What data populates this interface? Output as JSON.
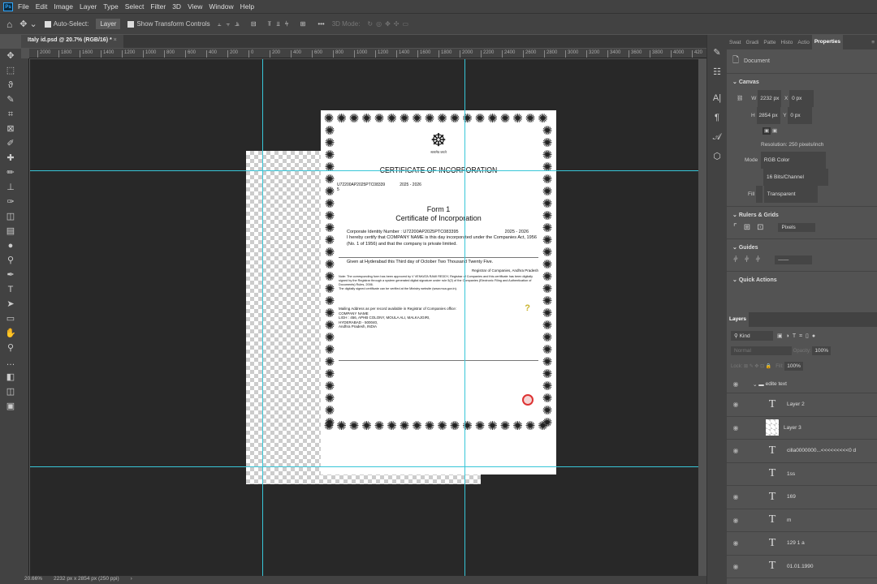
{
  "app_icon": "Ps",
  "menu": [
    "File",
    "Edit",
    "Image",
    "Layer",
    "Type",
    "Select",
    "Filter",
    "3D",
    "View",
    "Window",
    "Help"
  ],
  "options": {
    "auto_select": "Auto-Select:",
    "auto_select_target": "Layer",
    "show_transform": "Show Transform Controls",
    "mode_3d": "3D Mode:",
    "more": "•••"
  },
  "document_tab": {
    "title": "Italy id.psd @ 20.7% (RGB/16) *",
    "close": "×"
  },
  "ruler_top": [
    "2000",
    "1800",
    "1600",
    "1400",
    "1200",
    "1000",
    "800",
    "600",
    "400",
    "200",
    "0",
    "200",
    "400",
    "600",
    "800",
    "1000",
    "1200",
    "1400",
    "1600",
    "1800",
    "2000",
    "2200",
    "2400",
    "2600",
    "2800",
    "3000",
    "3200",
    "3400",
    "3600",
    "3800",
    "4000",
    "420"
  ],
  "certificate": {
    "ornament": "✺",
    "emblem": "☸",
    "emblem_caption": "सत्यमेव जयते",
    "heading": "CERTIFICATE OF INCORPORATION",
    "cin_top": "U72200AP2025PTC08339",
    "cin_top_cont": "5",
    "year_top": "2025 - 2026",
    "form": "Form 1",
    "subtitle": "Certificate of Incorporation",
    "cin_line": "Corporate Identity Number : U72200AP2025PTC083395",
    "year_line": "2025 - 2026",
    "certify": "I hereby certify that COMPANY NAME is this day incorporated under the Companies Act, 1956 (No. 1 of 1956) and that the company is private limited.",
    "given": "Given at Hyderabad this  Third day of October Two Thousand Twenty Five.",
    "registrar": "Registrar of Companies, Andhra Pradesh",
    "note": "Note: The corresponding form has been approved by V VENKATA RAMI REDDY, Registrar of Companies and this certificate has been digitally signed by the Registrar through a system generated digital signature under rule 5(2) of the Companies (Electronic Filing and Authentication of Documents) Rules, 2006.",
    "note2": "The digitally signed certificate can be verified at the Ministry website (www.mca.gov.in).",
    "mailing": [
      "Mailing Address as per record available in Registrar of Companies office:",
      "COMPANY NAME",
      "LIGH : 456, APHB COLONY, MOULA ALI, MALKAJGIRI,",
      "HYDERABAD - 500040,",
      "Andhra Pradesh, INDIA"
    ],
    "question_mark": "?"
  },
  "status": {
    "zoom": "20.66%",
    "doc_size": "2232 px x 2854 px (250 ppi)",
    "arrow": "›"
  },
  "panel_tabs": [
    "Swat",
    "Gradi",
    "Patte",
    "Histo",
    "Actio",
    "Properties"
  ],
  "properties": {
    "doc_label": "Document",
    "canvas_title": "Canvas",
    "w_label": "W",
    "w_value": "2232 px",
    "x_label": "X",
    "x_value": "0 px",
    "h_label": "H",
    "h_value": "2854 px",
    "y_label": "Y",
    "y_value": "0 px",
    "resolution": "Resolution: 250 pixels/inch",
    "mode_label": "Mode",
    "mode_value": "RGB Color",
    "depth_value": "16 Bits/Channel",
    "fill_label": "Fill",
    "fill_value": "Transparent",
    "rulers_title": "Rulers & Grids",
    "rulers_unit": "Pixels",
    "guides_title": "Guides",
    "quick_actions": "Quick Actions"
  },
  "layers_panel": {
    "title": "Layers",
    "filter": "Kind",
    "blend": "Normal",
    "opacity_label": "Opacity:",
    "opacity": "100%",
    "lock_label": "Lock:",
    "fill_label": "Fill:",
    "fill": "100%",
    "group": "edite text",
    "items": [
      {
        "name": "Layer 2",
        "type": "text",
        "visible": true
      },
      {
        "name": "Layer 3",
        "type": "image",
        "visible": true
      },
      {
        "name": "cilla0000000...<<<<<<<<<0 d",
        "type": "text",
        "visible": true
      },
      {
        "name": "1ss",
        "type": "text",
        "visible": false
      },
      {
        "name": "169",
        "type": "text",
        "visible": true
      },
      {
        "name": "m",
        "type": "text",
        "visible": true
      },
      {
        "name": "129 1 a",
        "type": "text",
        "visible": true
      },
      {
        "name": "01.01.1990",
        "type": "text",
        "visible": true
      }
    ],
    "text_glyph": "T",
    "eye_glyph": "◉"
  }
}
